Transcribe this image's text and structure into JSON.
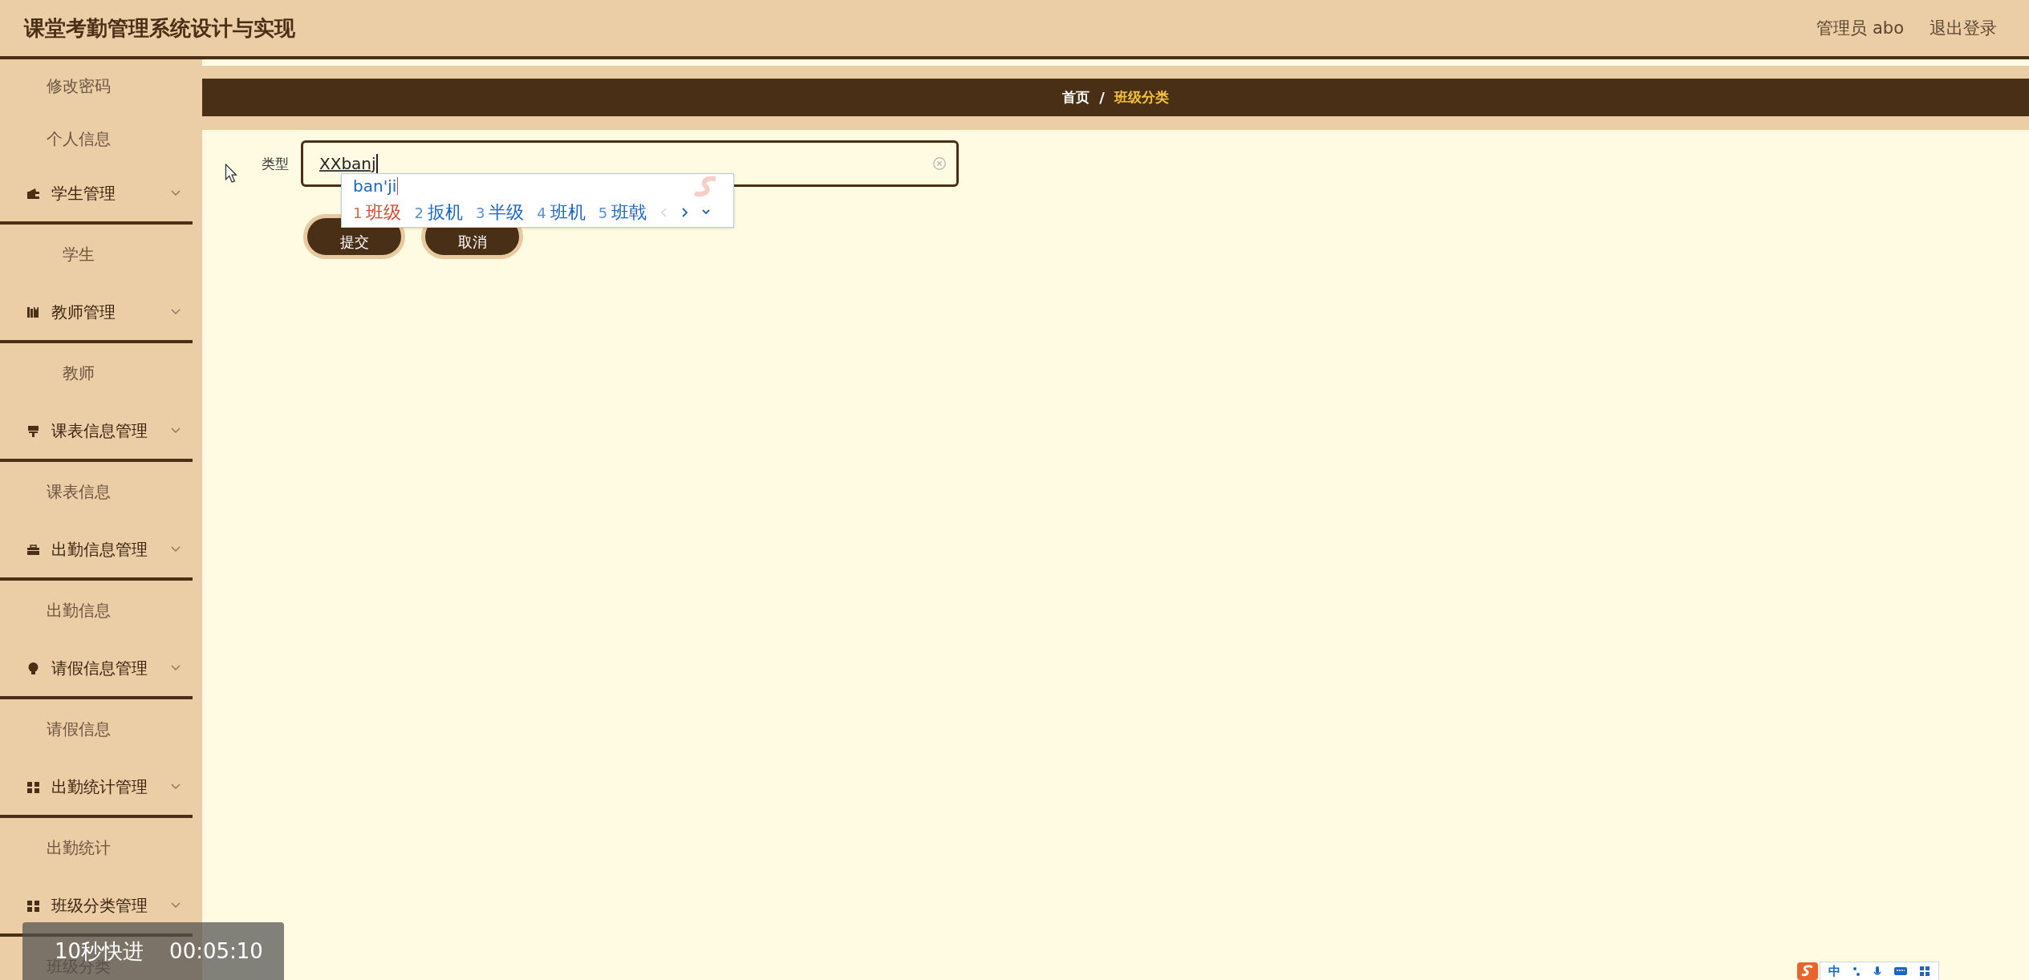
{
  "header": {
    "title": "课堂考勤管理系统设计与实现",
    "user": "管理员 abo",
    "logout": "退出登录"
  },
  "sidebar": {
    "items": [
      {
        "kind": "link",
        "label": "修改密码"
      },
      {
        "kind": "link",
        "label": "个人信息"
      },
      {
        "kind": "group",
        "label": "学生管理",
        "expanded": true,
        "children": [
          {
            "label": "学生"
          }
        ]
      },
      {
        "kind": "group",
        "label": "教师管理",
        "expanded": true,
        "children": [
          {
            "label": "教师"
          }
        ]
      },
      {
        "kind": "group",
        "label": "课表信息管理",
        "expanded": true,
        "children": [
          {
            "label": "课表信息"
          }
        ]
      },
      {
        "kind": "group",
        "label": "出勤信息管理",
        "expanded": true,
        "children": [
          {
            "label": "出勤信息"
          }
        ]
      },
      {
        "kind": "group",
        "label": "请假信息管理",
        "expanded": true,
        "children": [
          {
            "label": "请假信息"
          }
        ]
      },
      {
        "kind": "group",
        "label": "出勤统计管理",
        "expanded": true,
        "children": [
          {
            "label": "出勤统计"
          }
        ]
      },
      {
        "kind": "group",
        "label": "班级分类管理",
        "expanded": true,
        "children": [
          {
            "label": "班级分类"
          }
        ]
      }
    ]
  },
  "breadcrumb": {
    "separator": "/",
    "items": [
      {
        "label": "首页",
        "selected": false
      },
      {
        "label": "班级分类",
        "selected": true
      }
    ]
  },
  "form": {
    "label": "类型",
    "value": "XXbanj"
  },
  "ime_popup": {
    "composition": "ban'ji",
    "candidates": [
      {
        "number": "1",
        "text": "班级",
        "selected": true
      },
      {
        "number": "2",
        "text": "扳机",
        "selected": false
      },
      {
        "number": "3",
        "text": "半级",
        "selected": false
      },
      {
        "number": "4",
        "text": "班机",
        "selected": false
      },
      {
        "number": "5",
        "text": "班戟",
        "selected": false
      }
    ]
  },
  "buttons": [
    "提交",
    "取消"
  ],
  "video_overlay": {
    "label": "10秒快进",
    "time": "00:05:10"
  },
  "ime_toolbar": {
    "mode": "中"
  }
}
